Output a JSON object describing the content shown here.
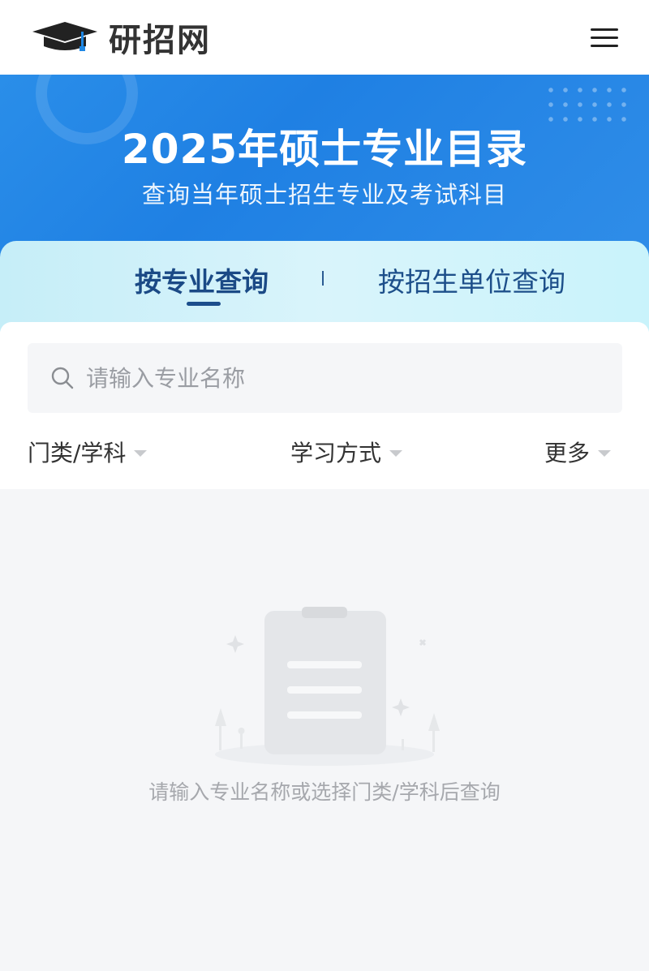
{
  "header": {
    "logo_text": "研招网",
    "logo_icon": "graduation-cap-icon",
    "menu_icon": "hamburger-menu-icon"
  },
  "banner": {
    "title": "2025年硕士专业目录",
    "subtitle": "查询当年硕士招生专业及考试科目"
  },
  "tabs": [
    {
      "label": "按专业查询",
      "active": true
    },
    {
      "label": "按招生单位查询",
      "active": false
    }
  ],
  "search": {
    "placeholder": "请输入专业名称",
    "value": ""
  },
  "filters": [
    {
      "label": "门类/学科"
    },
    {
      "label": "学习方式"
    },
    {
      "label": "更多"
    }
  ],
  "empty_state": {
    "message": "请输入专业名称或选择门类/学科后查询"
  },
  "colors": {
    "banner_blue": "#1f80e3",
    "tab_text": "#1b4a86",
    "page_bg": "#f5f6f8"
  }
}
